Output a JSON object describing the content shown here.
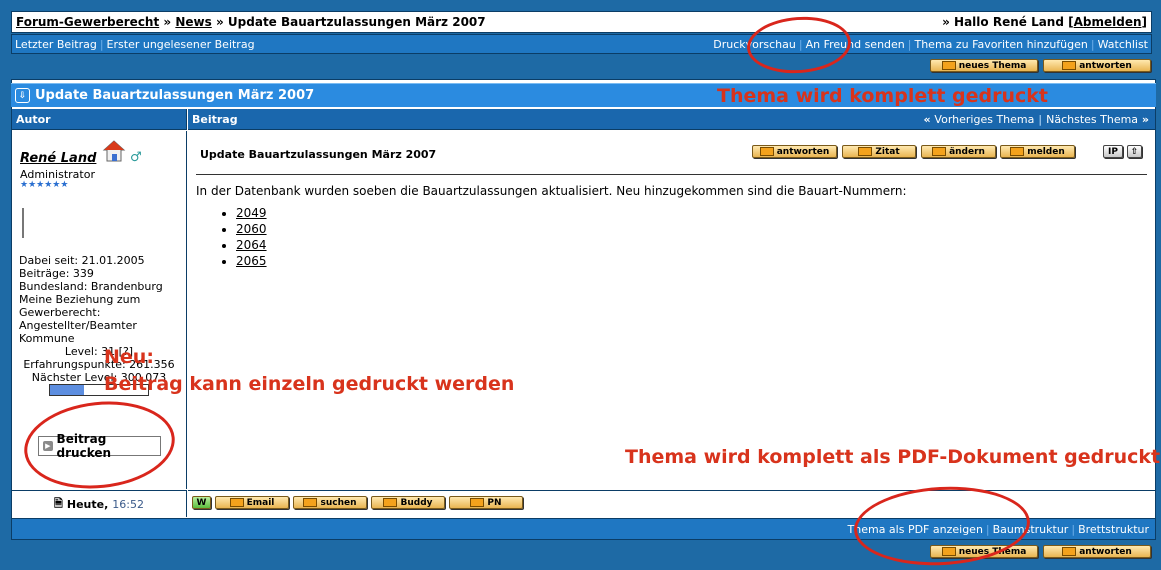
{
  "breadcrumb": {
    "forum": "Forum-Gewerberecht",
    "sep1": "»",
    "news": "News",
    "sep2": "»",
    "topic": "Update Bauartzulassungen März 2007"
  },
  "greeting": {
    "prefix": "» Hallo René Land [",
    "logout": "Abmelden",
    "suffix": "]"
  },
  "subnav": {
    "left": [
      "Letzter Beitrag",
      "Erster ungelesener Beitrag"
    ],
    "right": [
      "Druckvorschau",
      "An Freund senden",
      "Thema zu Favoriten hinzufügen",
      "Watchlist"
    ]
  },
  "buttons": {
    "new_topic": "neues Thema",
    "reply": "antworten"
  },
  "thread_title": "Update Bauartzulassungen März 2007",
  "columns": {
    "author": "Autor",
    "post": "Beitrag",
    "prev": "Vorheriges Thema",
    "next": "Nächstes Thema",
    "prev_arrow": "«",
    "next_arrow": "»"
  },
  "author": {
    "name": "René Land",
    "rank": "Administrator",
    "stars": "★★★★★★",
    "details": [
      "Dabei seit: 21.01.2005",
      "Beiträge: 339",
      "Bundesland: Brandenburg",
      "Meine Beziehung zum",
      "Gewerberecht:",
      "Angestellter/Beamter Kommune"
    ],
    "level": "Level: 31 [?]",
    "xp": "Erfahrungspunkte: 261.356",
    "next_level": "Nächster Level: 300.073",
    "progress": 0.35,
    "print_post": "Beitrag drucken"
  },
  "post": {
    "title": "Update Bauartzulassungen März 2007",
    "actions": [
      "antworten",
      "Zitat",
      "ändern",
      "melden"
    ],
    "ip": "IP",
    "body": "In der Datenbank wurden soeben die Bauartzulassungen aktualisiert. Neu hinzugekommen sind die Bauart-Nummern:",
    "links": [
      "2049",
      "2060",
      "2064",
      "2065"
    ]
  },
  "footer": {
    "date": "Heute,",
    "time": "16:52",
    "contact": [
      "W",
      "Email",
      "suchen",
      "Buddy",
      "PN"
    ]
  },
  "bottomnav": [
    "Thema als PDF anzeigen",
    "Baumstruktur",
    "Brettstruktur"
  ],
  "annotations": {
    "print_full": "Thema wird komplett gedruckt",
    "new_label": "Neu:",
    "print_single": "Beitrag kann einzeln gedruckt werden",
    "print_pdf": "Thema wird komplett als PDF-Dokument gedruckt"
  },
  "colors": {
    "background": "#1e6aa5",
    "header": "#2b8be0",
    "annotation": "#d8331c",
    "button": "#e9b552"
  }
}
